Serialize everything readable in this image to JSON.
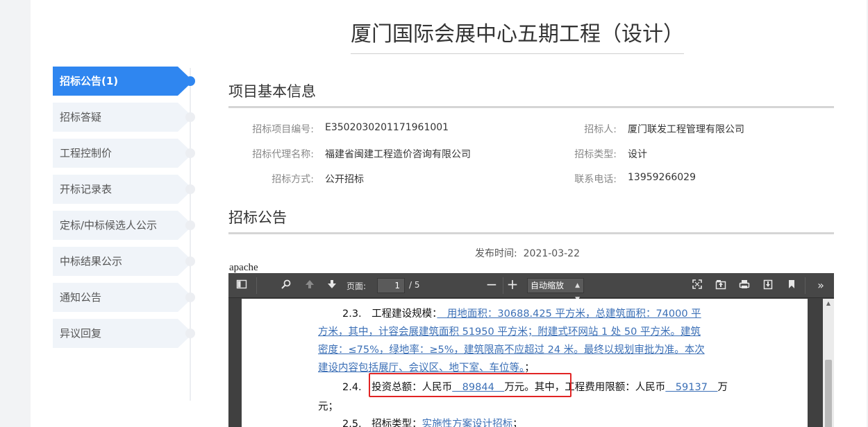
{
  "page_title": "厦门国际会展中心五期工程（设计）",
  "sidebar": {
    "items": [
      {
        "label": "招标公告(1)",
        "active": true
      },
      {
        "label": "招标答疑"
      },
      {
        "label": "工程控制价"
      },
      {
        "label": "开标记录表"
      },
      {
        "label": "定标/中标候选人公示"
      },
      {
        "label": "中标结果公示"
      },
      {
        "label": "通知公告"
      },
      {
        "label": "异议回复"
      }
    ]
  },
  "basic_info": {
    "title": "项目基本信息",
    "fields": [
      {
        "label": "招标项目编号:",
        "value": "E3502030201171961001"
      },
      {
        "label": "招标人:",
        "value": "厦门联发工程管理有限公司"
      },
      {
        "label": "招标代理名称:",
        "value": "福建省闽建工程造价咨询有限公司"
      },
      {
        "label": "招标类型:",
        "value": "设计"
      },
      {
        "label": "招标方式:",
        "value": "公开招标"
      },
      {
        "label": "联系电话:",
        "value": "13959266029"
      }
    ]
  },
  "notice": {
    "title": "招标公告",
    "publish_label": "发布时间:",
    "publish_date": "2021-03-22",
    "apache_text": "apache"
  },
  "pdf_viewer": {
    "page_label": "页面:",
    "current_page": "1",
    "total_pages": "/ 5",
    "zoom": "自动缩放",
    "lines": {
      "l1_prefix": "2.3.　工程建设规模：",
      "l1_link": "　用地面积：30688.425 平方米，总建筑面积：74000 平",
      "l2_link": "方米，其中，计容会展建筑面积 51950 平方米；附建式环网站 1 处 50 平方米。建筑",
      "l3_link": "密度：≤75%，绿地率：≥5%，建筑限高不应超过 24 米。最终以规划审批为准。本次",
      "l4_link": "建设内容包括展厅、会议区、地下室、车位等。",
      "l4_suffix": "；",
      "l5_prefix": "2.4.　投资总额：人民币",
      "l5_value1": "　89844　",
      "l5_mid": "万元。其中，工程费用限额：人民币",
      "l5_value2": "　59137　",
      "l5_suffix": "万",
      "l6": "元；",
      "l7_prefix": "2.5.　招标类型：",
      "l7_link": "实施性方案设计招标",
      "l7_suffix": "；"
    }
  },
  "colors": {
    "accent": "#2f86f0",
    "highlight_box": "#e12424",
    "link": "#3b6fb6"
  }
}
